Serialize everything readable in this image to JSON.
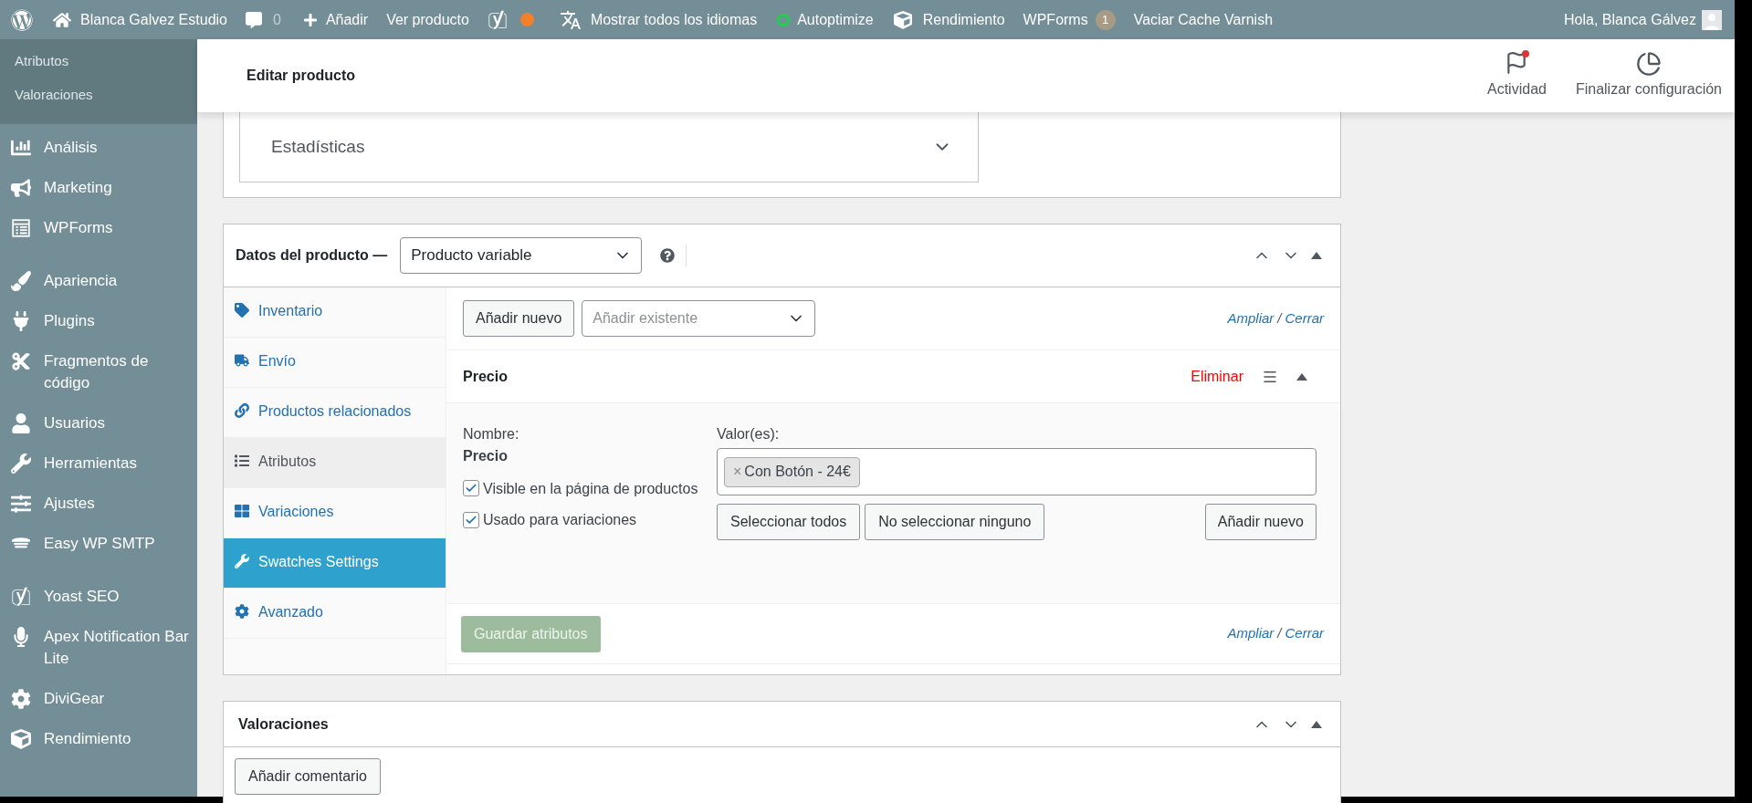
{
  "admin_bar": {
    "site": "Blanca Galvez Estudio",
    "comments": "0",
    "new": "Añadir",
    "view": "Ver producto",
    "languages": "Mostrar todos los idiomas",
    "autoptimize": "Autoptimize",
    "performance": "Rendimiento",
    "wpforms": "WPForms",
    "wpforms_badge": "1",
    "varnish": "Vaciar Cache Varnish",
    "greeting": "Hola, Blanca Gálvez"
  },
  "sidebar": {
    "submenu": [
      {
        "label": "Atributos"
      },
      {
        "label": "Valoraciones"
      }
    ],
    "groups": [
      {
        "items": [
          {
            "label": "Análisis"
          },
          {
            "label": "Marketing"
          },
          {
            "label": "WPForms"
          }
        ]
      },
      {
        "items": [
          {
            "label": "Apariencia"
          },
          {
            "label": "Plugins"
          },
          {
            "label": "Fragmentos de código"
          },
          {
            "label": "Usuarios"
          },
          {
            "label": "Herramientas"
          },
          {
            "label": "Ajustes"
          },
          {
            "label": "Easy WP SMTP"
          }
        ]
      },
      {
        "items": [
          {
            "label": "Yoast SEO"
          },
          {
            "label": "Apex Notification Bar Lite"
          },
          {
            "label": "DiviGear"
          },
          {
            "label": "Rendimiento"
          }
        ]
      }
    ]
  },
  "header": {
    "title": "Editar producto",
    "activity": "Actividad",
    "activity_unread": true,
    "setup": "Finalizar configuración"
  },
  "stats": {
    "label": "Estadísticas"
  },
  "product_data": {
    "title": "Datos del producto —",
    "type": "Producto variable",
    "tabs": [
      {
        "label": "Inventario",
        "selected": false,
        "hovered": false
      },
      {
        "label": "Envío",
        "selected": false,
        "hovered": false
      },
      {
        "label": "Productos relacionados",
        "selected": false,
        "hovered": false
      },
      {
        "label": "Atributos",
        "selected": true,
        "hovered": false
      },
      {
        "label": "Variaciones",
        "selected": false,
        "hovered": false
      },
      {
        "label": "Swatches Settings",
        "selected": false,
        "hovered": true
      },
      {
        "label": "Avanzado",
        "selected": false,
        "hovered": false
      }
    ],
    "add_new": "Añadir nuevo",
    "existing_placeholder": "Añadir existente",
    "top_links": {
      "expand": "Ampliar",
      "separator": "/",
      "close": "Cerrar"
    },
    "bottom_links": {
      "expand": "Ampliar",
      "separator": "/",
      "close": "Cerrar"
    },
    "attribute": {
      "name": "Precio",
      "remove": "Eliminar",
      "name_label": "Nombre:",
      "name_value": "Precio",
      "visible_label": "Visible en la página de productos",
      "visible": true,
      "variations_label": "Usado para variaciones",
      "variations": true,
      "values_label": "Valor(es):",
      "values": [
        {
          "remove": "×",
          "label": "Con Botón - 24€"
        }
      ],
      "select_all": "Seleccionar todos",
      "select_none": "No seleccionar ninguno",
      "add_new": "Añadir nuevo"
    },
    "save": "Guardar atributos",
    "save_disabled": true
  },
  "reviews": {
    "title": "Valoraciones",
    "add": "Añadir comentario"
  }
}
